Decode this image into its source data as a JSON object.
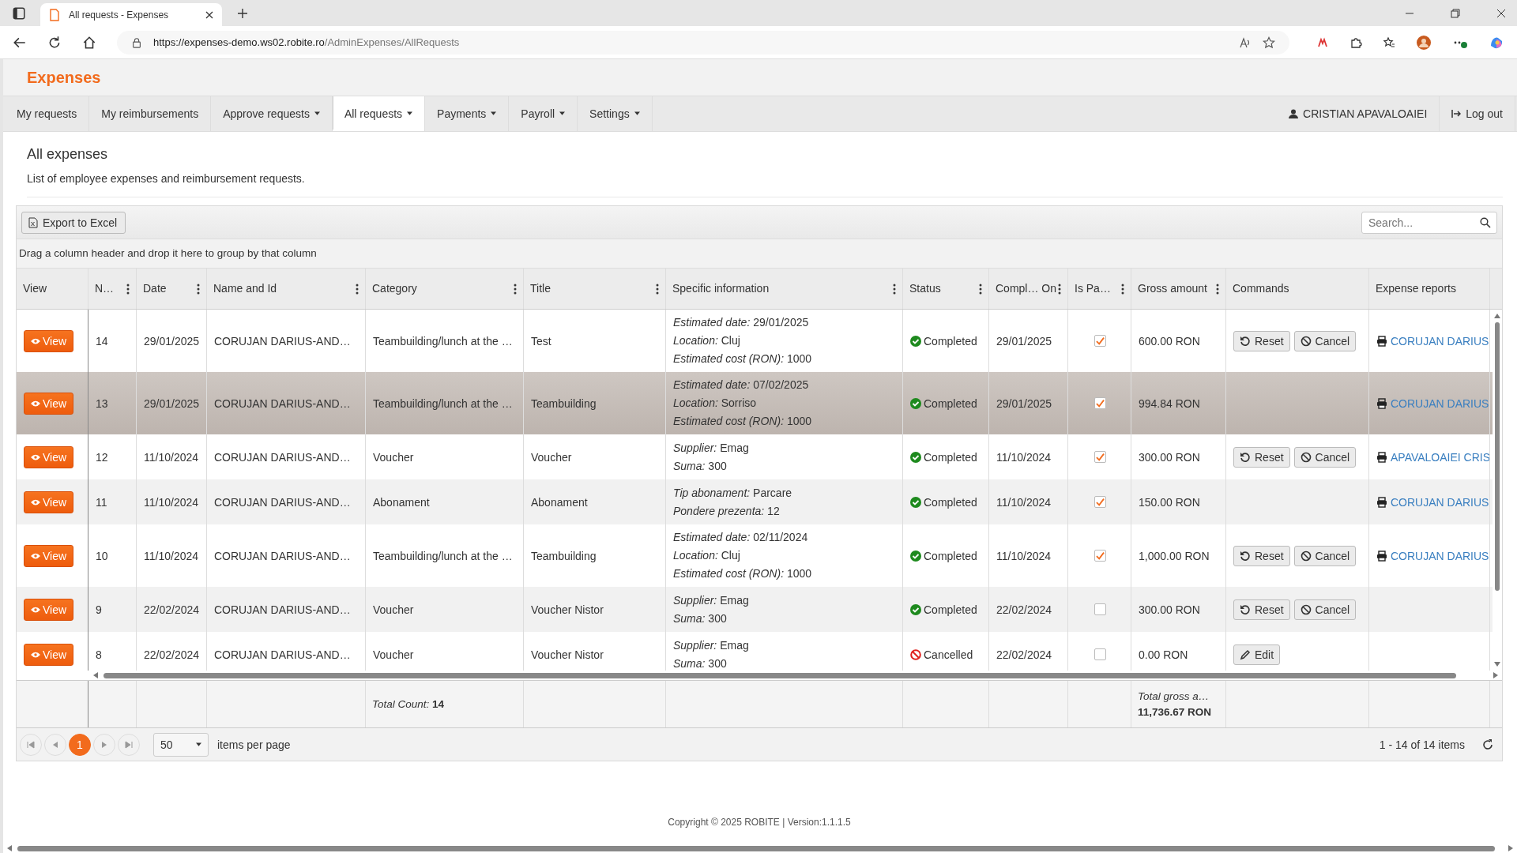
{
  "browser": {
    "tab_title": "All requests - Expenses",
    "url_host": "https://expenses-demo.ws02.robite.ro",
    "url_path": "/AdminExpenses/AllRequests"
  },
  "app": {
    "title": "Expenses"
  },
  "nav": [
    {
      "label": "My requests",
      "selected": false,
      "dropdown": false
    },
    {
      "label": "My reimbursements",
      "selected": false,
      "dropdown": false
    },
    {
      "label": "Approve requests",
      "selected": false,
      "dropdown": true
    },
    {
      "label": "All requests",
      "selected": true,
      "dropdown": true
    },
    {
      "label": "Payments",
      "selected": false,
      "dropdown": true
    },
    {
      "label": "Payroll",
      "selected": false,
      "dropdown": true
    },
    {
      "label": "Settings",
      "selected": false,
      "dropdown": true
    }
  ],
  "user": {
    "name": "CRISTIAN APAVALOAIEI",
    "logout": "Log out"
  },
  "page": {
    "title": "All expenses",
    "subtitle": "List of employee expenses and reimbursement requests."
  },
  "toolbar": {
    "export": "Export to Excel",
    "search_placeholder": "Search..."
  },
  "group_hint": "Drag a column header and drop it here to group by that column",
  "columns": [
    {
      "label": "View",
      "menu": false
    },
    {
      "label": "N…",
      "menu": true
    },
    {
      "label": "Date",
      "menu": true
    },
    {
      "label": "Name and Id",
      "menu": true
    },
    {
      "label": "Category",
      "menu": true
    },
    {
      "label": "Title",
      "menu": true
    },
    {
      "label": "Specific information",
      "menu": true
    },
    {
      "label": "Status",
      "menu": true
    },
    {
      "label": "Compl… On",
      "menu": true
    },
    {
      "label": "Is Pa…",
      "menu": true
    },
    {
      "label": "Gross amount",
      "menu": true
    },
    {
      "label": "Commands",
      "menu": false
    },
    {
      "label": "Expense reports",
      "menu": false
    }
  ],
  "rows": [
    {
      "view": "View",
      "no": "14",
      "date": "29/01/2025",
      "name": "CORUJAN DARIUS-AND…",
      "category": "Teambuilding/lunch at the …",
      "title": "Test",
      "info": [
        {
          "label": "Estimated date:",
          "value": "29/01/2025"
        },
        {
          "label": "Location:",
          "value": "Cluj"
        },
        {
          "label": "Estimated cost (RON):",
          "value": "1000"
        }
      ],
      "status": {
        "kind": "completed",
        "text": "Completed"
      },
      "completed_on": "29/01/2025",
      "paid": true,
      "gross": "600.00 RON",
      "commands": [
        {
          "kind": "reset",
          "label": "Reset"
        },
        {
          "kind": "cancel",
          "label": "Cancel"
        }
      ],
      "report": "CORUJAN DARIUS",
      "selected": false
    },
    {
      "view": "View",
      "no": "13",
      "date": "29/01/2025",
      "name": "CORUJAN DARIUS-AND…",
      "category": "Teambuilding/lunch at the …",
      "title": "Teambuilding",
      "info": [
        {
          "label": "Estimated date:",
          "value": "07/02/2025"
        },
        {
          "label": "Location:",
          "value": "Sorriso"
        },
        {
          "label": "Estimated cost (RON):",
          "value": "1000"
        }
      ],
      "status": {
        "kind": "completed",
        "text": "Completed"
      },
      "completed_on": "29/01/2025",
      "paid": true,
      "gross": "994.84 RON",
      "commands": [],
      "report": "CORUJAN DARIUS",
      "selected": true
    },
    {
      "view": "View",
      "no": "12",
      "date": "11/10/2024",
      "name": "CORUJAN DARIUS-AND…",
      "category": "Voucher",
      "title": "Voucher",
      "info": [
        {
          "label": "Supplier:",
          "value": "Emag"
        },
        {
          "label": "Suma:",
          "value": "300"
        }
      ],
      "status": {
        "kind": "completed",
        "text": "Completed"
      },
      "completed_on": "11/10/2024",
      "paid": true,
      "gross": "300.00 RON",
      "commands": [
        {
          "kind": "reset",
          "label": "Reset"
        },
        {
          "kind": "cancel",
          "label": "Cancel"
        }
      ],
      "report": "APAVALOAIEI CRIS",
      "selected": false
    },
    {
      "view": "View",
      "no": "11",
      "date": "11/10/2024",
      "name": "CORUJAN DARIUS-AND…",
      "category": "Abonament",
      "title": "Abonament",
      "info": [
        {
          "label": "Tip abonament:",
          "value": "Parcare"
        },
        {
          "label": "Pondere prezenta:",
          "value": "12"
        }
      ],
      "status": {
        "kind": "completed",
        "text": "Completed"
      },
      "completed_on": "11/10/2024",
      "paid": true,
      "gross": "150.00 RON",
      "commands": [],
      "report": "CORUJAN DARIUS",
      "selected": false
    },
    {
      "view": "View",
      "no": "10",
      "date": "11/10/2024",
      "name": "CORUJAN DARIUS-AND…",
      "category": "Teambuilding/lunch at the …",
      "title": "Teambuilding",
      "info": [
        {
          "label": "Estimated date:",
          "value": "02/11/2024"
        },
        {
          "label": "Location:",
          "value": "Cluj"
        },
        {
          "label": "Estimated cost (RON):",
          "value": "1000"
        }
      ],
      "status": {
        "kind": "completed",
        "text": "Completed"
      },
      "completed_on": "11/10/2024",
      "paid": true,
      "gross": "1,000.00 RON",
      "commands": [
        {
          "kind": "reset",
          "label": "Reset"
        },
        {
          "kind": "cancel",
          "label": "Cancel"
        }
      ],
      "report": "CORUJAN DARIUS",
      "selected": false
    },
    {
      "view": "View",
      "no": "9",
      "date": "22/02/2024",
      "name": "CORUJAN DARIUS-AND…",
      "category": "Voucher",
      "title": "Voucher Nistor",
      "info": [
        {
          "label": "Supplier:",
          "value": "Emag"
        },
        {
          "label": "Suma:",
          "value": "300"
        }
      ],
      "status": {
        "kind": "completed",
        "text": "Completed"
      },
      "completed_on": "22/02/2024",
      "paid": false,
      "gross": "300.00 RON",
      "commands": [
        {
          "kind": "reset",
          "label": "Reset"
        },
        {
          "kind": "cancel",
          "label": "Cancel"
        }
      ],
      "report": "",
      "selected": false
    },
    {
      "view": "View",
      "no": "8",
      "date": "22/02/2024",
      "name": "CORUJAN DARIUS-AND…",
      "category": "Voucher",
      "title": "Voucher Nistor",
      "info": [
        {
          "label": "Supplier:",
          "value": "Emag"
        },
        {
          "label": "Suma:",
          "value": "300"
        }
      ],
      "status": {
        "kind": "cancelled",
        "text": "Cancelled"
      },
      "completed_on": "22/02/2024",
      "paid": false,
      "gross": "0.00 RON",
      "commands": [
        {
          "kind": "edit",
          "label": "Edit"
        }
      ],
      "report": "",
      "selected": false
    }
  ],
  "footer": {
    "count_label": "Total Count:",
    "count_value": "14",
    "gross_label": "Total gross a…",
    "gross_value": "11,736.67 RON"
  },
  "pager": {
    "pages": [
      {
        "label": "1",
        "selected": true
      }
    ],
    "page_size": "50",
    "per_page_label": "items per page",
    "range": "1 - 14 of 14 items"
  },
  "copyright": "Copyright © 2025 ROBITE | Version:1.1.1.5"
}
